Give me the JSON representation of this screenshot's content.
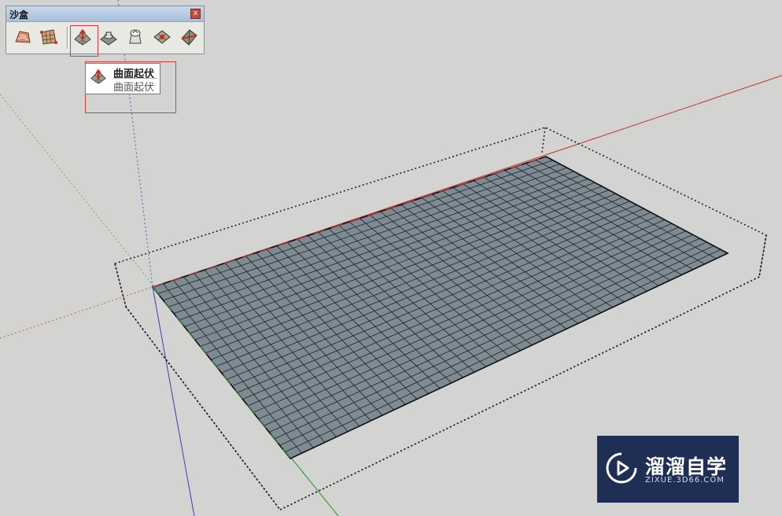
{
  "toolbar": {
    "title": "沙盒",
    "close_label": "x",
    "tools": [
      {
        "name": "from-contours-icon"
      },
      {
        "name": "from-scratch-icon"
      },
      {
        "name": "smoove-icon"
      },
      {
        "name": "stamp-icon"
      },
      {
        "name": "drape-icon"
      },
      {
        "name": "add-detail-icon"
      },
      {
        "name": "flip-edge-icon"
      }
    ]
  },
  "tooltip": {
    "title": "曲面起伏",
    "description": "曲面起伏"
  },
  "watermark": {
    "title": "溜溜自学",
    "subtitle": "ZIXUE.3D66.COM"
  },
  "colors": {
    "background": "#d3d3d1",
    "grid_face": "#7f8b93",
    "grid_line": "#1c2226",
    "highlight": "#e03a3a",
    "axis_red": "#c23a3a",
    "axis_green": "#2f9a2f",
    "axis_blue": "#3a3ac2",
    "watermark_bg": "#1f2e55"
  }
}
